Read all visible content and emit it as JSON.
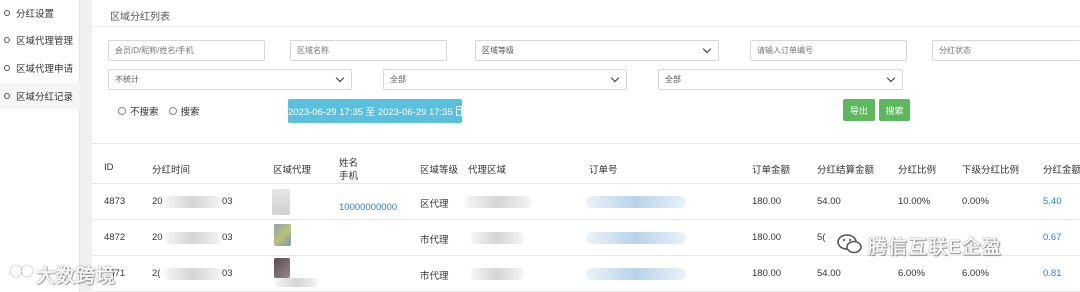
{
  "sidebar": {
    "items": [
      {
        "label": "分红设置"
      },
      {
        "label": "区域代理管理"
      },
      {
        "label": "区域代理申请"
      },
      {
        "label": "区域分红记录"
      }
    ]
  },
  "panel": {
    "title": "区域分红列表"
  },
  "filters": {
    "member_placeholder": "会员ID/昵称/姓名/手机",
    "region_name_placeholder": "区域名称",
    "region_level_value": "区域等级",
    "order_no_placeholder": "请输入订单编号",
    "dividend_status_placeholder": "分红状态",
    "time_filter_value": "不统计",
    "select_all_1": "全部",
    "select_all_2": "全部",
    "radio_no_search": "不搜索",
    "radio_search": "搜索",
    "date_range": "2023-06-29 17:35 至 2023-06-29 17:35",
    "export_label": "导出",
    "search_label": "搜索"
  },
  "table": {
    "headers": {
      "id": "ID",
      "time": "分红时间",
      "agent": "区域代理",
      "name": "姓名",
      "phone": "手机",
      "level": "区域等级",
      "region": "代理区域",
      "order_no": "订单号",
      "order_amount": "订单金额",
      "settle_amount": "分红结算金额",
      "ratio": "分红比例",
      "sub_ratio": "下级分红比例",
      "dividend": "分红金额"
    },
    "rows": [
      {
        "id": "4873",
        "time_prefix": "20",
        "time_suffix": "03",
        "phone": "10000000000",
        "level": "区代理",
        "order_amount": "180.00",
        "settle_amount": "54.00",
        "ratio": "10.00%",
        "sub_ratio": "0.00%",
        "dividend": "5.40"
      },
      {
        "id": "4872",
        "time_prefix": "20",
        "time_suffix": "03",
        "phone": "",
        "level": "市代理",
        "order_amount": "180.00",
        "settle_amount": "5(",
        "ratio": "",
        "sub_ratio": "",
        "dividend": "0.67"
      },
      {
        "id": "4871",
        "time_prefix": "2(",
        "time_suffix": "03",
        "phone": "",
        "level": "市代理",
        "order_amount": "180.00",
        "settle_amount": "54.00",
        "ratio": "6.00%",
        "sub_ratio": "6.00%",
        "dividend": "0.81"
      }
    ]
  },
  "watermarks": {
    "left": "大数跨境",
    "right": "腾信互联E企盈"
  },
  "colors": {
    "accent_blue": "#5bc0de",
    "button_green": "#5cb85c",
    "link_blue": "#2f7fbf"
  }
}
